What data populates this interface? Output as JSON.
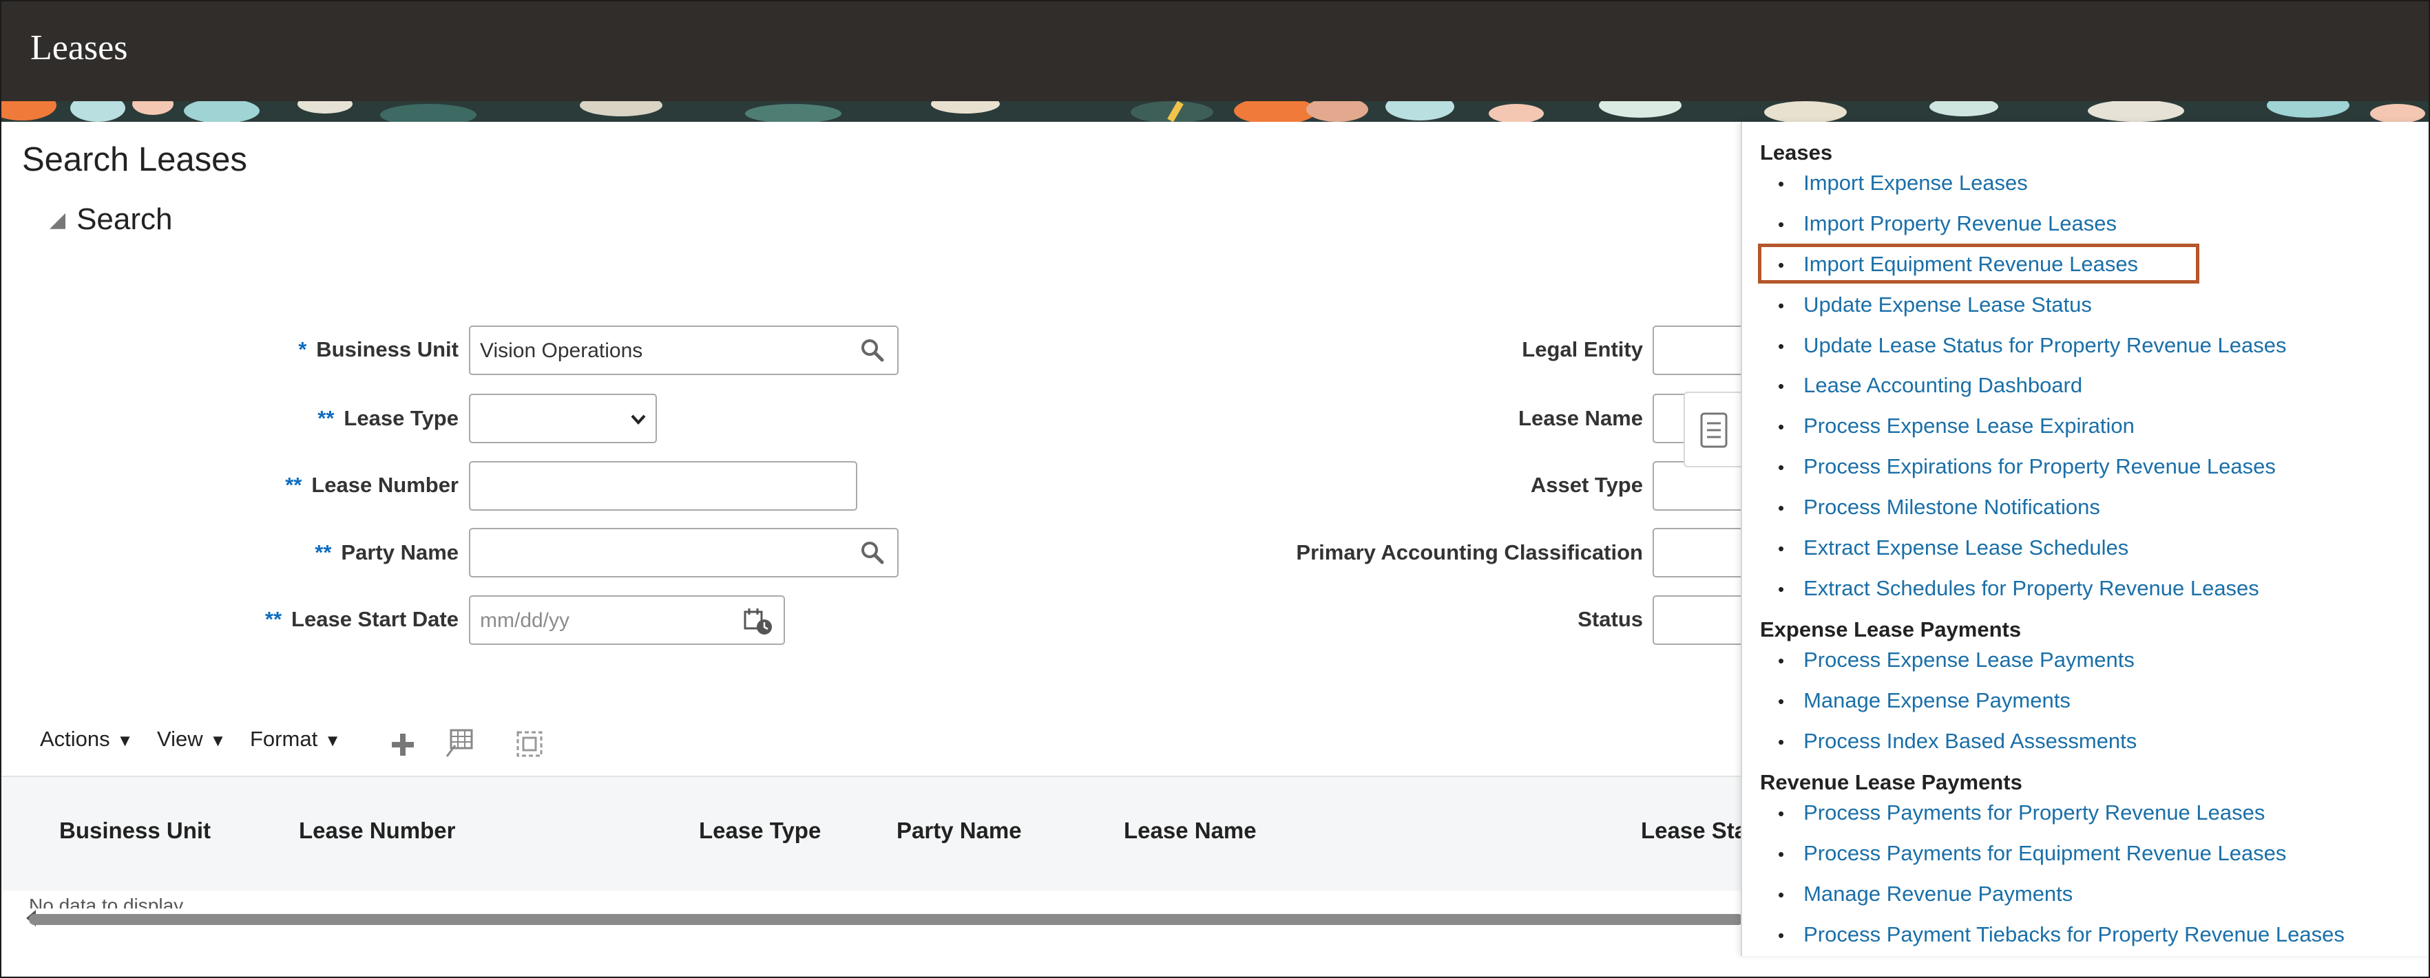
{
  "app": {
    "title": "Leases"
  },
  "page": {
    "title": "Search Leases",
    "search_section": "Search"
  },
  "search_form": {
    "business_unit": {
      "label": "Business Unit",
      "required_marker": "*",
      "value": "Vision Operations"
    },
    "lease_type": {
      "label": "Lease Type",
      "required_marker": "**",
      "value": ""
    },
    "lease_number": {
      "label": "Lease Number",
      "required_marker": "**",
      "value": ""
    },
    "party_name": {
      "label": "Party Name",
      "required_marker": "**",
      "value": ""
    },
    "lease_start_date": {
      "label": "Lease Start Date",
      "required_marker": "**",
      "placeholder": "mm/dd/yy"
    },
    "legal_entity": {
      "label": "Legal Entity"
    },
    "lease_name": {
      "label": "Lease Name"
    },
    "asset_type": {
      "label": "Asset Type"
    },
    "primary_accounting_classification": {
      "label": "Primary Accounting Classification"
    },
    "status": {
      "label": "Status"
    }
  },
  "toolbar": {
    "actions": "Actions",
    "view": "View",
    "format": "Format"
  },
  "results_table": {
    "columns": [
      "Business Unit",
      "Lease Number",
      "Lease Type",
      "Party Name",
      "Lease Name",
      "Lease Sta"
    ],
    "empty_message": "No data to display."
  },
  "task_panel": {
    "groups": [
      {
        "title": "Leases",
        "items": [
          "Import Expense Leases",
          "Import Property Revenue Leases",
          "Import Equipment Revenue Leases",
          "Update Expense Lease Status",
          "Update Lease Status for Property Revenue Leases",
          "Lease Accounting Dashboard",
          "Process Expense Lease Expiration",
          "Process Expirations for Property Revenue Leases",
          "Process Milestone Notifications",
          "Extract Expense Lease Schedules",
          "Extract Schedules for Property Revenue Leases"
        ]
      },
      {
        "title": "Expense Lease Payments",
        "items": [
          "Process Expense Lease Payments",
          "Manage Expense Payments",
          "Process Index Based Assessments"
        ]
      },
      {
        "title": "Revenue Lease Payments",
        "items": [
          "Process Payments for Property Revenue Leases",
          "Process Payments for Equipment Revenue Leases",
          "Manage Revenue Payments",
          "Process Payment Tiebacks for Property Revenue Leases"
        ]
      }
    ],
    "highlighted_item": "Import Equipment Revenue Leases"
  },
  "colors": {
    "header_bg": "#312d2a",
    "link": "#1a6fa8",
    "required": "#0f6dbf",
    "highlight": "#b5562b"
  },
  "icons": [
    "search-icon",
    "chevron-down-icon",
    "calendar-icon",
    "add-icon",
    "freeze-columns-icon",
    "detach-icon",
    "notes-icon"
  ]
}
